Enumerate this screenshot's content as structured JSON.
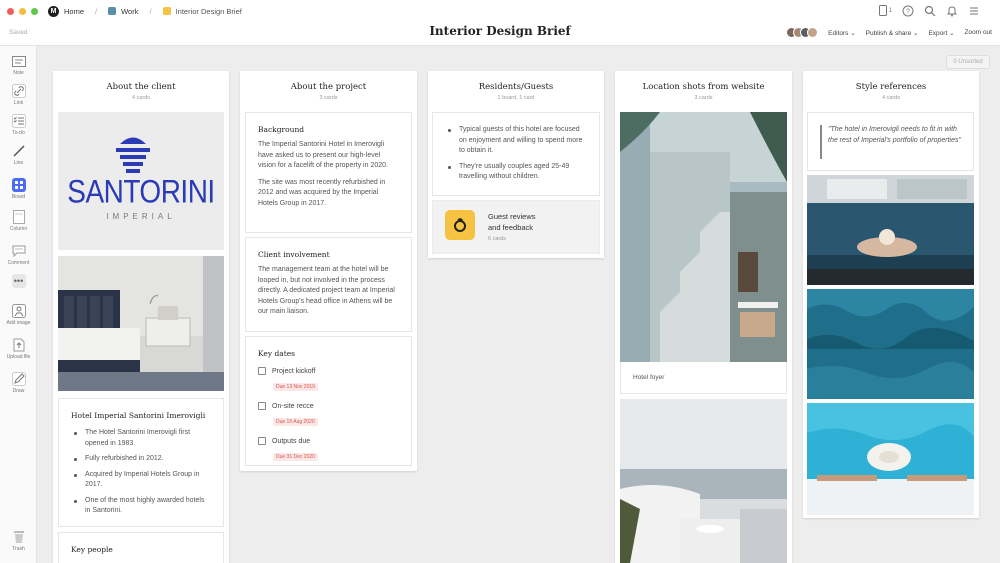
{
  "breadcrumb": {
    "home": "Home",
    "work": "Work",
    "board": "Interior Design Brief"
  },
  "topbar": {
    "notifications_count": "1"
  },
  "status": "Saved",
  "title": "Interior Design Brief",
  "actions": {
    "editors": "Editors",
    "publish": "Publish & share",
    "export": "Export",
    "zoom": "Zoom out"
  },
  "toolbar": [
    "Note",
    "Link",
    "To-do",
    "Line",
    "Board",
    "Column",
    "Comment",
    "Add image",
    "Upload file",
    "Draw",
    "Trash"
  ],
  "unsorted": "0 Unsorted",
  "colors": {
    "accent_board": "#4a6cf7",
    "due_red": "#d9534f",
    "santorini_blue": "#2a3bb5",
    "guest_yellow": "#f5c242"
  },
  "columns": {
    "client": {
      "title": "About the client",
      "count": "4 cards",
      "logo": {
        "name": "SANTORINI",
        "sub": "IMPERIAL"
      },
      "hotel_title": "Hotel Imperial Santorini Imerovigli",
      "hotel_items": [
        "The Hotel Santorini Imerovigli first opened in 1983.",
        "Fully refurbished in 2012.",
        "Acquired by Imperial Hotels Group in 2017.",
        "One of the most highly awarded hotels in Santorini."
      ],
      "key_people": "Key people"
    },
    "project": {
      "title": "About the project",
      "count": "3 cards",
      "background_title": "Background",
      "background_p1": "The Imperial Santorini Hotel in Imerovigli have asked us to present our high-level vision for a facelift of the property in 2020.",
      "background_p2": "The site was most recently refurbished in 2012 and was acquired by the Imperial Hotels Group in 2017.",
      "client_title": "Client involvement",
      "client_p": "The management team at the hotel will be looped in, but not involved in the process directly. A dedicated project team at Imperial Hotels Group's head office in Athens will be our main liaison.",
      "dates_title": "Key dates",
      "dates": [
        {
          "label": "Project kickoff",
          "due": "Due 13 Nov 2019"
        },
        {
          "label": "On-site recce",
          "due": "Due 15 Aug 2020"
        },
        {
          "label": "Outputs due",
          "due": "Due 31 Dec 2020"
        }
      ]
    },
    "residents": {
      "title": "Residents/Guests",
      "count": "1 board, 1 card",
      "items": [
        "Typical guests of this hotel are focused on enjoyment and willing to spend more to obtain it.",
        "They're usually couples aged 25-49 travelling without children."
      ],
      "board_title_1": "Guest reviews",
      "board_title_2": "and feedback",
      "board_count": "6 cards"
    },
    "location": {
      "title": "Location shots from website",
      "count": "3 cards",
      "caption": "Hotel foyer"
    },
    "style": {
      "title": "Style references",
      "count": "4 cards",
      "quote": "\"The hotel in Imerovigli needs to fit in with the rest of Imperial's portfolio of properties\""
    }
  }
}
